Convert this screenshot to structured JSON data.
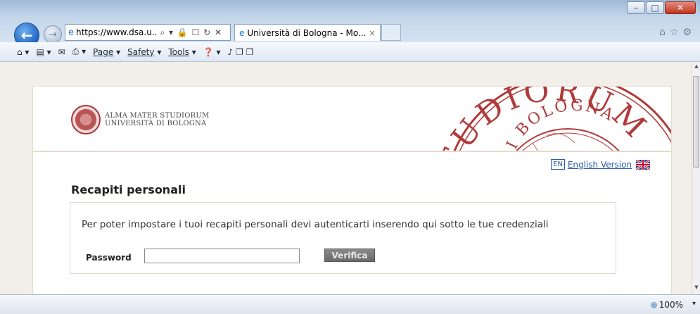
{
  "browser": {
    "address_url_bold": "https://www.dsa.u..",
    "address_url_rest": "",
    "address_tools": "⌕ ▾ 🔒 ☐ ↻ ✕",
    "tab_title": "Università di Bologna - Mo...",
    "tab_close": "×",
    "window": {
      "minimize": "–",
      "maximize": "□",
      "close": "✕"
    },
    "back_icon": "←",
    "forward_icon": "→",
    "ie_icon": "e",
    "right_icons": "⌂☆⚙",
    "command_bar": {
      "home": "⌂ ▾",
      "feeds": "▤ ▾",
      "mail": "✉",
      "print": "⎙ ▾",
      "page_label": "Page",
      "safety_label": "Safety",
      "tools_label": "Tools",
      "help": "❓ ▾",
      "extra": "♪ ❐ ❐",
      "dropdown": "▾"
    }
  },
  "site": {
    "logo_line1": "ALMA MATER STUDIORUM",
    "logo_line2": "UNIVERSITÀ DI BOLOGNA",
    "seal_text_top": "STUDIORUM",
    "seal_text_mid": "DI BOLOGNA",
    "en_badge": "EN",
    "english_link": "English Version",
    "heading": "Recapiti personali",
    "message": "Per poter impostare i tuoi recapiti personali devi autenticarti inserendo qui sotto le tue credenziali",
    "password_label": "Password",
    "password_value": "",
    "verify_button": "Verifica"
  },
  "status": {
    "zoom_icon": "⊕",
    "zoom": "100%",
    "zoom_dropdown": "▾"
  },
  "colors": {
    "seal_red": "#b03a3a",
    "link_blue": "#2a5aa8",
    "page_bg": "#f2efe8"
  }
}
